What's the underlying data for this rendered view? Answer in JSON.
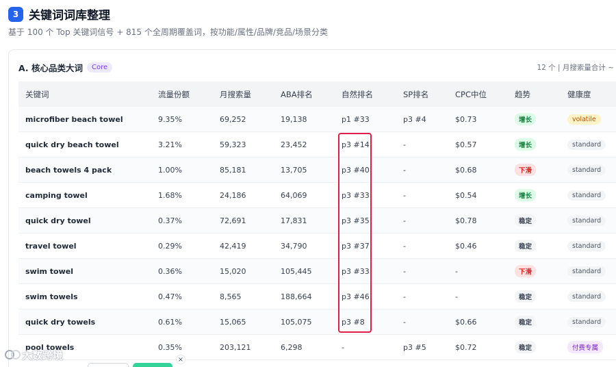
{
  "section": {
    "step": "3",
    "title": "关键词词库整理",
    "subtitle": "基于 100 个 Top 关键词信号 + 815 个全周期覆盖词，按功能/属性/品牌/竞品/场景分类"
  },
  "card": {
    "title": "A. 核心品类大词",
    "badge": "Core",
    "meta": "12 个 | 月搜索量合计 ~"
  },
  "table": {
    "headers": [
      "关键词",
      "流量份额",
      "月搜索量",
      "ABA排名",
      "自然排名",
      "SP排名",
      "CPC中位",
      "趋势",
      "健康度"
    ],
    "rows": [
      {
        "keyword": "microfiber beach towel",
        "share": "9.35%",
        "volume": "69,252",
        "aba": "19,138",
        "organic": "p1 #33",
        "sp": "p3 #4",
        "cpc": "$0.73",
        "trend": "增长",
        "trend_type": "up",
        "health": "volatile",
        "health_type": "volatile"
      },
      {
        "keyword": "quick dry beach towel",
        "share": "3.21%",
        "volume": "59,323",
        "aba": "23,452",
        "organic": "p3 #14",
        "sp": "-",
        "cpc": "$0.57",
        "trend": "增长",
        "trend_type": "up",
        "health": "standard",
        "health_type": "standard"
      },
      {
        "keyword": "beach towels 4 pack",
        "share": "1.00%",
        "volume": "85,181",
        "aba": "13,705",
        "organic": "p3 #40",
        "sp": "-",
        "cpc": "$0.68",
        "trend": "下滑",
        "trend_type": "down",
        "health": "standard",
        "health_type": "standard"
      },
      {
        "keyword": "camping towel",
        "share": "1.68%",
        "volume": "24,186",
        "aba": "64,069",
        "organic": "p3 #33",
        "sp": "-",
        "cpc": "$0.54",
        "trend": "增长",
        "trend_type": "up",
        "health": "standard",
        "health_type": "standard"
      },
      {
        "keyword": "quick dry towel",
        "share": "0.37%",
        "volume": "72,691",
        "aba": "17,831",
        "organic": "p3 #35",
        "sp": "-",
        "cpc": "$0.78",
        "trend": "稳定",
        "trend_type": "flat",
        "health": "standard",
        "health_type": "standard"
      },
      {
        "keyword": "travel towel",
        "share": "0.29%",
        "volume": "42,419",
        "aba": "34,790",
        "organic": "p3 #37",
        "sp": "-",
        "cpc": "$0.46",
        "trend": "稳定",
        "trend_type": "flat",
        "health": "standard",
        "health_type": "standard"
      },
      {
        "keyword": "swim towel",
        "share": "0.36%",
        "volume": "15,020",
        "aba": "105,445",
        "organic": "p3 #33",
        "sp": "-",
        "cpc": "-",
        "trend": "下滑",
        "trend_type": "down",
        "health": "standard",
        "health_type": "standard"
      },
      {
        "keyword": "swim towels",
        "share": "0.47%",
        "volume": "8,565",
        "aba": "188,664",
        "organic": "p3 #46",
        "sp": "-",
        "cpc": "-",
        "trend": "稳定",
        "trend_type": "flat",
        "health": "standard",
        "health_type": "standard"
      },
      {
        "keyword": "quick dry towels",
        "share": "0.61%",
        "volume": "15,065",
        "aba": "105,075",
        "organic": "p3 #8",
        "sp": "-",
        "cpc": "$0.66",
        "trend": "稳定",
        "trend_type": "flat",
        "health": "standard",
        "health_type": "standard"
      },
      {
        "keyword": "pool towels",
        "share": "0.35%",
        "volume": "203,121",
        "aba": "6,298",
        "organic": "-",
        "sp": "p3 #5",
        "cpc": "$0.72",
        "trend": "稳定",
        "trend_type": "flat",
        "health": "付费专属",
        "health_type": "paid"
      }
    ]
  },
  "watermark": "大数跨境",
  "close_label": "×",
  "colors": {
    "accent": "#2563eb",
    "highlight": "#e11d48",
    "trend_up": "#15803d",
    "trend_down": "#dc2626"
  }
}
